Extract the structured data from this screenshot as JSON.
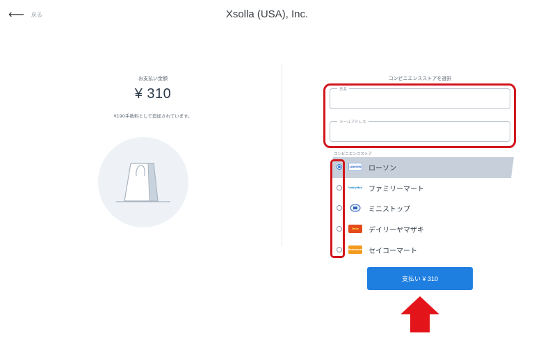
{
  "header": {
    "back_label": "戻る",
    "merchant": "Xsolla (USA), Inc."
  },
  "summary": {
    "amount_label": "お支払い金額",
    "amount": "¥ 310",
    "fee_note": "¥190手数料として追加されています。"
  },
  "form": {
    "section_title": "コンビニエンスストアを選択",
    "name_label": "氏名",
    "name_value": "",
    "email_label": "メールアドレス",
    "email_value": "",
    "stores_label": "コンビニエンスストア",
    "stores": [
      {
        "name": "ローソン",
        "logo_text": "LAWSON",
        "selected": true
      },
      {
        "name": "ファミリーマート",
        "logo_text": "FamilyMart",
        "selected": false
      },
      {
        "name": "ミニストップ",
        "logo_text": "",
        "selected": false
      },
      {
        "name": "デイリーヤマザキ",
        "logo_text": "Daily",
        "selected": false
      },
      {
        "name": "セイコーマート",
        "logo_text": "Seicomart",
        "selected": false
      }
    ]
  },
  "pay_button": "支払い ¥ 310",
  "colors": {
    "accent": "#1f7fe0",
    "highlight": "#d2151c",
    "selected_row": "#c7d0da"
  }
}
